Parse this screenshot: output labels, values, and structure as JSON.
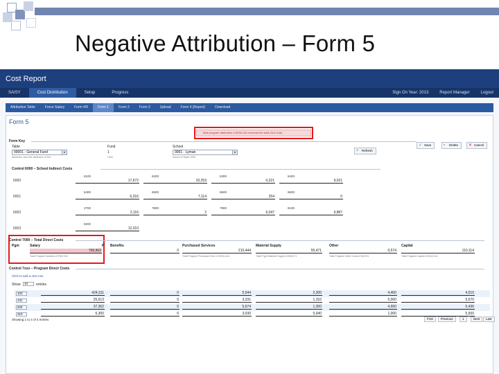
{
  "slide": {
    "title": "Negative Attribution – Form 5"
  },
  "app": {
    "title": "Cost Report",
    "nav": [
      "SAISY",
      "Cost Distribution",
      "Setup",
      "Progress"
    ],
    "nav_active": 1,
    "right": [
      "Sign On Year: 2013",
      "Report Manager",
      "Logout"
    ],
    "tabs": [
      "Attribution Table",
      "Force Salary",
      "Form 4/5",
      "Form 1",
      "Form 2",
      "Form 3",
      "Upload",
      "Form 4 (Report)",
      "Download"
    ],
    "tab_active": 3
  },
  "form": {
    "title": "Form 5",
    "notice": "Total program attribution of $760,311 exceeds the total 2011 total.",
    "key_section": "Form Key",
    "table_label": "Table",
    "table_value": "00001 - General Fund",
    "table_sub": "Attribution from the attribution of SAI",
    "fund_label": "Fund",
    "fund_value": "1",
    "fund_sub": "1000",
    "school_label": "School",
    "school_value": "0001 - Lyman",
    "school_sub": "School of Wash 2006",
    "refresh_label": "Refresh",
    "save_label": "Save",
    "delete_label": "Delete",
    "cancel_label": "Cancel"
  },
  "indirect": {
    "title": "Control 6000 – School Indirect Costs",
    "rows": [
      {
        "code": "6000",
        "caps": [
          "6100",
          "6200",
          "6300",
          "6400"
        ],
        "vals": [
          "17,672",
          "32,253",
          "0,221",
          "9,021"
        ]
      },
      {
        "code": "6001",
        "caps": [
          "6400",
          "6500",
          "6600",
          "6600"
        ],
        "vals": [
          "6,316",
          "7,114",
          "254",
          "0"
        ]
      },
      {
        "code": "6002",
        "caps": [
          "2700",
          "7800",
          "7900",
          "8100"
        ],
        "vals": [
          "2,116",
          "2",
          "6,047",
          "9,887"
        ]
      },
      {
        "code": "6003",
        "caps": [
          "8200"
        ],
        "vals": [
          "12,310"
        ]
      }
    ]
  },
  "direct": {
    "title": "Control 7000 – Total Direct Costs",
    "pgm_label": "Pgm",
    "headers": [
      "Salary",
      "P",
      "Benefits",
      "Purchased Services",
      "Material Supply",
      "Other",
      "Capital"
    ],
    "values": [
      "760,902",
      "0",
      "210,444",
      "55,471",
      "0,574",
      "110,114"
    ],
    "notes": [
      "Total Program Salaries of $760,902",
      "Total Program Purchased Serv. of $210,444",
      "Total Prgm Material Supply of $55,471",
      "Total Program Other Costs of $0,574",
      "Total Program Capital of $110,114"
    ]
  },
  "program": {
    "title": "Control 7xxx – Program Direct Costs",
    "add_link": "Click to add a new row",
    "show_label": "Show",
    "show_value": "10",
    "entries_label": "entries",
    "rows": [
      {
        "pgm": "103",
        "vals": [
          "424,311",
          "0",
          "5,544",
          "2,300",
          "4,400",
          "4,510"
        ]
      },
      {
        "pgm": "131",
        "vals": [
          "25,613",
          "0",
          "3,331",
          "1,152",
          "5,000",
          "5,670"
        ]
      },
      {
        "pgm": "204",
        "vals": [
          "37,362",
          "0",
          "5,674",
          "1,300",
          "4,900",
          "5,436"
        ]
      },
      {
        "pgm": "310",
        "vals": [
          "6,300",
          "0",
          "3,030",
          "5,940",
          "1,000",
          "5,500"
        ]
      }
    ],
    "showing": "Showing 1 to 4 of 4 entries",
    "pager": [
      "First",
      "Previous",
      "1",
      "Next",
      "Last"
    ]
  }
}
